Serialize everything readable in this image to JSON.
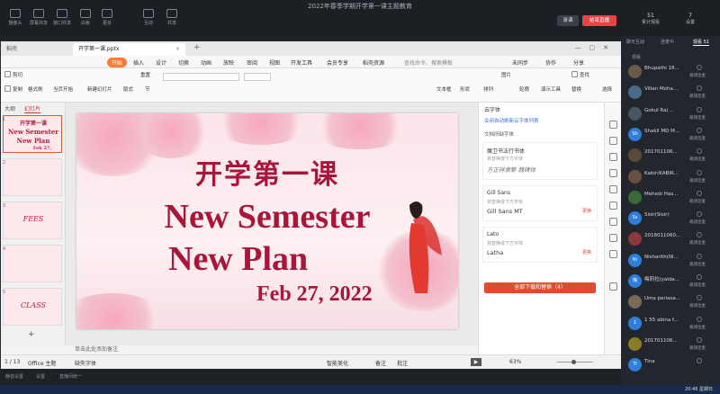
{
  "meeting": {
    "title": "2022年春季学期开学第一课主题教育",
    "tools": [
      "摄像头",
      "屏幕共享",
      "窗口共享",
      "白板",
      "更多",
      "互动",
      "共享"
    ],
    "share_label": "录课",
    "end_label": "结束直播",
    "stats": [
      {
        "value": "51",
        "label": "累计观看"
      },
      {
        "value": "7",
        "label": "设置"
      }
    ]
  },
  "ppt": {
    "tab_home": "稻壳",
    "tab_doc": "开学第一课.pptx",
    "menus": [
      "开始",
      "插入",
      "设计",
      "切换",
      "动画",
      "放映",
      "审阅",
      "视图",
      "开发工具",
      "会员专享",
      "稻壳资源"
    ],
    "menu_right": [
      "未同步",
      "协作",
      "分享"
    ],
    "search": "查找命令、搜索模板",
    "ribbon": {
      "cut": "剪切",
      "copy": "复制",
      "paste": "粘贴",
      "format_painter": "格式刷",
      "from_start": "当页开始",
      "new_slide": "新建幻灯片",
      "layout": "版式",
      "section": "节",
      "reset": "重置",
      "textbox": "文本框",
      "shape": "形状",
      "arrange": "排列",
      "picture": "图片",
      "find": "查找",
      "replace": "替换",
      "select": "选择",
      "slideshow": "演示工具",
      "outline": "轮廓"
    },
    "thumb_tabs": [
      "大纲",
      "幻灯片"
    ],
    "thumbs": [
      {
        "num": "1",
        "line1": "开学第一课",
        "line2": "New Semester",
        "line3": "New Plan",
        "line4": "Feb 27,"
      },
      {
        "num": "2",
        "line1": ""
      },
      {
        "num": "3",
        "line1": "FEES"
      },
      {
        "num": "4",
        "line1": ""
      },
      {
        "num": "5",
        "line1": "CLASS"
      }
    ],
    "slide": {
      "cn": "开学第一课",
      "en1": "New Semester",
      "en2": "New Plan",
      "date": "Feb 27, 2022"
    },
    "notes": "单击此处添加备注",
    "font_panel": {
      "head": "云字体",
      "hint": "关闭自动刷新云字体列表",
      "section": "文档所缺字体",
      "fonts": [
        {
          "name": "魔卫书法行书体",
          "sub": "将替换成下方字体",
          "sample": "方正祥隶繁 魏碑体",
          "link": ""
        },
        {
          "name": "Gill Sans",
          "sub": "将替换成下方字体",
          "sample": "Gill Sans MT",
          "link": "更换"
        },
        {
          "name": "Lato",
          "sub": "将替换成下方字体",
          "sample": "Latha",
          "link": "更换"
        }
      ],
      "download": "全部下载和替换（4）"
    },
    "status": {
      "page": "1 / 13",
      "theme": "Office 主题",
      "missing": "缺失字体",
      "beautify": "智能美化",
      "notes": "备注",
      "comment": "批注",
      "zoom": "63%"
    }
  },
  "participants_panel": {
    "tabs": [
      "聊天互动",
      "连麦中",
      "观看 51"
    ],
    "sub": "观看",
    "people": [
      {
        "name": "Bhupathi 18...",
        "tag": "邀请连麦",
        "initial": "",
        "color": "#6a5a4a"
      },
      {
        "name": "Villan Moha...",
        "tag": "邀请连麦",
        "initial": "",
        "color": "#4a6a8a"
      },
      {
        "name": "Gokul Raj ...",
        "tag": "邀请连麦",
        "initial": "",
        "color": "#4a5560"
      },
      {
        "name": "Shakil MD M...",
        "tag": "邀请连麦",
        "initial": "Sh",
        "color": "#2f7fd8"
      },
      {
        "name": "201701106...",
        "tag": "邀请连麦",
        "initial": "",
        "color": "#5a4a3a"
      },
      {
        "name": "Kabir(KABIR...",
        "tag": "邀请连麦",
        "initial": "",
        "color": "#6a5040"
      },
      {
        "name": "Mehedi Has...",
        "tag": "邀请连麦",
        "initial": "",
        "color": "#3a6a3a"
      },
      {
        "name": "Sisir(Sisir)",
        "tag": "邀请连麦",
        "initial": "Ss",
        "color": "#2f7fd8"
      },
      {
        "name": "2018011060...",
        "tag": "邀请连麦",
        "initial": "",
        "color": "#8a3a3a"
      },
      {
        "name": "Nisharith(Ni...",
        "tag": "邀请连麦",
        "initial": "Ni",
        "color": "#2f7fd8"
      },
      {
        "name": "梅莉拉(yalda...",
        "tag": "邀请连麦",
        "initial": "梅",
        "color": "#2f7fd8"
      },
      {
        "name": "Uma periasa...",
        "tag": "邀请连麦",
        "initial": "",
        "color": "#7a6a5a"
      },
      {
        "name": "1 55 abina f...",
        "tag": "邀请连麦",
        "initial": "1",
        "color": "#2f7fd8"
      },
      {
        "name": "201701106...",
        "tag": "邀请连麦",
        "initial": "",
        "color": "#8a7a2a"
      },
      {
        "name": "Tina",
        "tag": "",
        "initial": "Ti",
        "color": "#2f7fd8"
      }
    ]
  },
  "bottom": {
    "items": [
      "静音设置",
      "设置",
      "直播间统一"
    ],
    "clock": "20:46 星期日"
  },
  "colors": {
    "accent": "#ff7a34",
    "slide_title": "#a8173a",
    "end_button": "#e64545"
  }
}
